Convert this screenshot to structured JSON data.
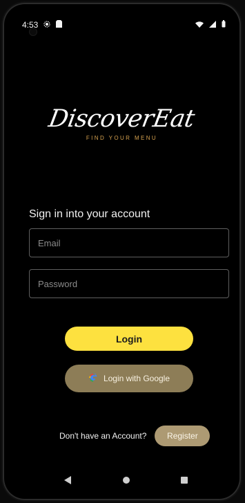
{
  "status": {
    "time": "4:53",
    "left_icons": [
      "settings-icon",
      "sim-card-icon"
    ],
    "right_icons": [
      "wifi-icon",
      "signal-icon",
      "battery-icon"
    ]
  },
  "brand": {
    "title": "DiscoverEat",
    "subtitle": "FIND YOUR MENU",
    "accent_color": "#d5a14f"
  },
  "form": {
    "heading": "Sign in into your account",
    "email_placeholder": "Email",
    "password_placeholder": "Password"
  },
  "actions": {
    "login_label": "Login",
    "google_label": "Login with Google",
    "no_account_text": "Don't have an Account?",
    "register_label": "Register",
    "login_color": "#fde13f",
    "google_color": "#8d7d57",
    "register_color": "#ad9a73"
  },
  "navigation": {
    "icons": [
      "back-icon",
      "home-icon",
      "recent-apps-icon"
    ]
  }
}
